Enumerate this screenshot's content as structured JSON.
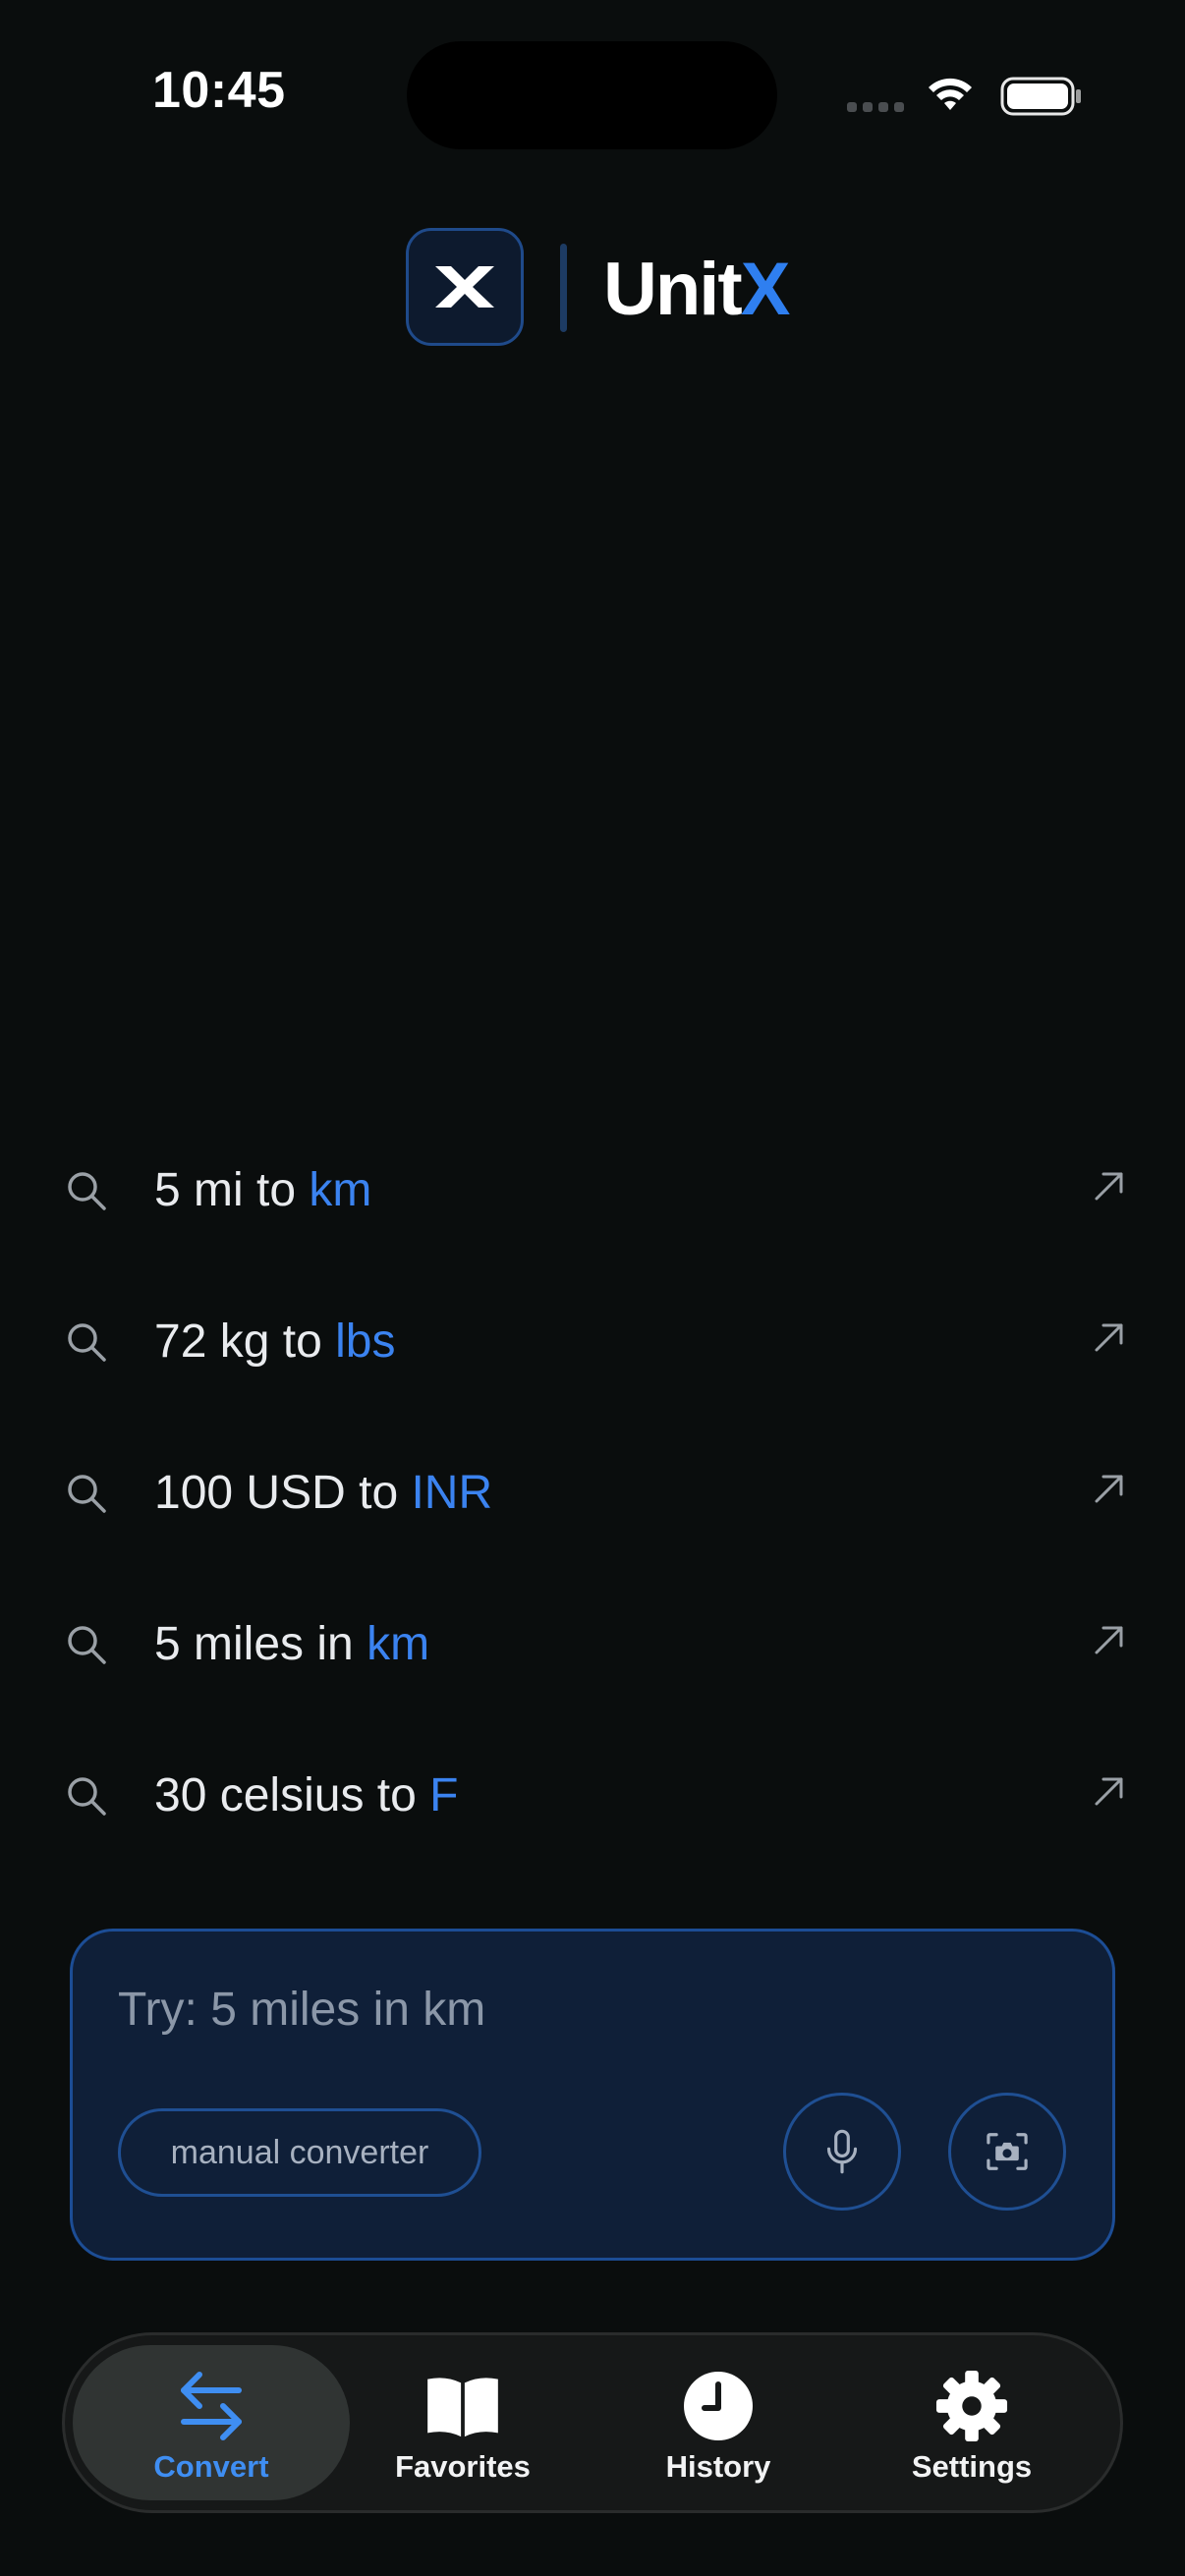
{
  "status_bar": {
    "time": "10:45"
  },
  "header": {
    "title_main": "Unit",
    "title_accent": "X",
    "logo_icon": "x-logo-icon"
  },
  "suggestions": [
    {
      "prefix": "5 mi to ",
      "unit": "km",
      "icon": "search-icon",
      "action_icon": "arrow-up-right-icon"
    },
    {
      "prefix": "72 kg to ",
      "unit": "lbs",
      "icon": "search-icon",
      "action_icon": "arrow-up-right-icon"
    },
    {
      "prefix": "100 USD to ",
      "unit": "INR",
      "icon": "search-icon",
      "action_icon": "arrow-up-right-icon"
    },
    {
      "prefix": "5 miles in ",
      "unit": "km",
      "icon": "search-icon",
      "action_icon": "arrow-up-right-icon"
    },
    {
      "prefix": "30 celsius to ",
      "unit": "F",
      "icon": "search-icon",
      "action_icon": "arrow-up-right-icon"
    }
  ],
  "input_card": {
    "placeholder": "Try: 5 miles in km",
    "value": "",
    "manual_label": "manual converter",
    "mic_icon": "microphone-icon",
    "camera_icon": "camera-scan-icon"
  },
  "tab_bar": {
    "active": "Convert",
    "tabs": [
      {
        "label": "Convert",
        "icon": "swap-arrows-icon"
      },
      {
        "label": "Favorites",
        "icon": "book-icon"
      },
      {
        "label": "History",
        "icon": "clock-icon"
      },
      {
        "label": "Settings",
        "icon": "gear-icon"
      }
    ]
  },
  "colors": {
    "background": "#0a0d0d",
    "accent": "#2f7ff0",
    "card_bg": "#0f1f38",
    "card_border": "#1c4d95"
  }
}
